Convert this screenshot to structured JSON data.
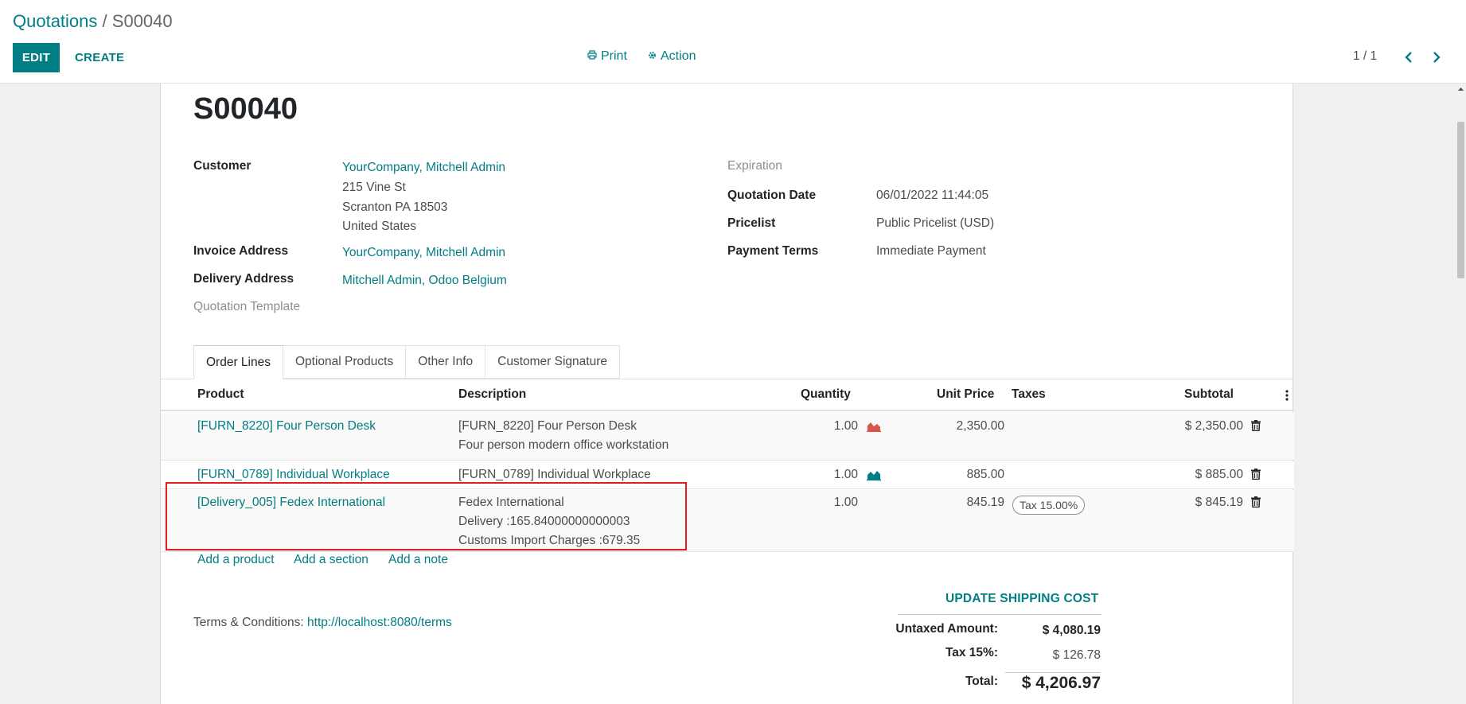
{
  "breadcrumb": {
    "parent": "Quotations",
    "separator": "/",
    "current": "S00040"
  },
  "toolbar": {
    "edit_label": "EDIT",
    "create_label": "CREATE",
    "print_label": "Print",
    "action_label": "Action"
  },
  "pager": {
    "value": "1 / 1"
  },
  "record": {
    "name": "S00040",
    "customer_label": "Customer",
    "customer_name": "YourCompany, Mitchell Admin",
    "customer_address": [
      "215 Vine St",
      "Scranton PA 18503",
      "United States"
    ],
    "invoice_address_label": "Invoice Address",
    "invoice_address": "YourCompany, Mitchell Admin",
    "delivery_address_label": "Delivery Address",
    "delivery_address": "Mitchell Admin, Odoo Belgium",
    "template_label": "Quotation Template",
    "expiration_label": "Expiration",
    "quotation_date_label": "Quotation Date",
    "quotation_date": "06/01/2022 11:44:05",
    "pricelist_label": "Pricelist",
    "pricelist": "Public Pricelist (USD)",
    "payment_terms_label": "Payment Terms",
    "payment_terms": "Immediate Payment"
  },
  "tabs": [
    {
      "label": "Order Lines",
      "active": true
    },
    {
      "label": "Optional Products",
      "active": false
    },
    {
      "label": "Other Info",
      "active": false
    },
    {
      "label": "Customer Signature",
      "active": false
    }
  ],
  "table": {
    "headers": {
      "product": "Product",
      "description": "Description",
      "quantity": "Quantity",
      "unit_price": "Unit Price",
      "taxes": "Taxes",
      "subtotal": "Subtotal"
    },
    "rows": [
      {
        "product": "[FURN_8220] Four Person Desk",
        "description": [
          "[FURN_8220] Four Person Desk",
          "Four person modern office workstation"
        ],
        "quantity": "1.00",
        "forecast_color": "#d9534f",
        "unit_price": "2,350.00",
        "tax": "",
        "subtotal": "$ 2,350.00"
      },
      {
        "product": "[FURN_0789] Individual Workplace",
        "description": [
          "[FURN_0789] Individual Workplace"
        ],
        "quantity": "1.00",
        "forecast_color": "#017e84",
        "unit_price": "885.00",
        "tax": "",
        "subtotal": "$ 885.00"
      },
      {
        "product": "[Delivery_005] Fedex International",
        "description": [
          "Fedex International",
          "Delivery :165.84000000000003",
          "Customs Import Charges :679.35"
        ],
        "quantity": "1.00",
        "forecast_color": "",
        "unit_price": "845.19",
        "tax": "Tax 15.00%",
        "subtotal": "$ 845.19"
      }
    ],
    "add_links": {
      "product": "Add a product",
      "section": "Add a section",
      "note": "Add a note"
    }
  },
  "terms": {
    "label": "Terms & Conditions:",
    "link": "http://localhost:8080/terms"
  },
  "totals": {
    "update_shipping_label": "UPDATE SHIPPING COST",
    "untaxed_label": "Untaxed Amount:",
    "untaxed_value": "$ 4,080.19",
    "tax_label": "Tax 15%:",
    "tax_value": "$ 126.78",
    "total_label": "Total:",
    "total_value": "$ 4,206.97"
  },
  "colors": {
    "primary": "#017e84",
    "highlight": "#e01b24"
  }
}
